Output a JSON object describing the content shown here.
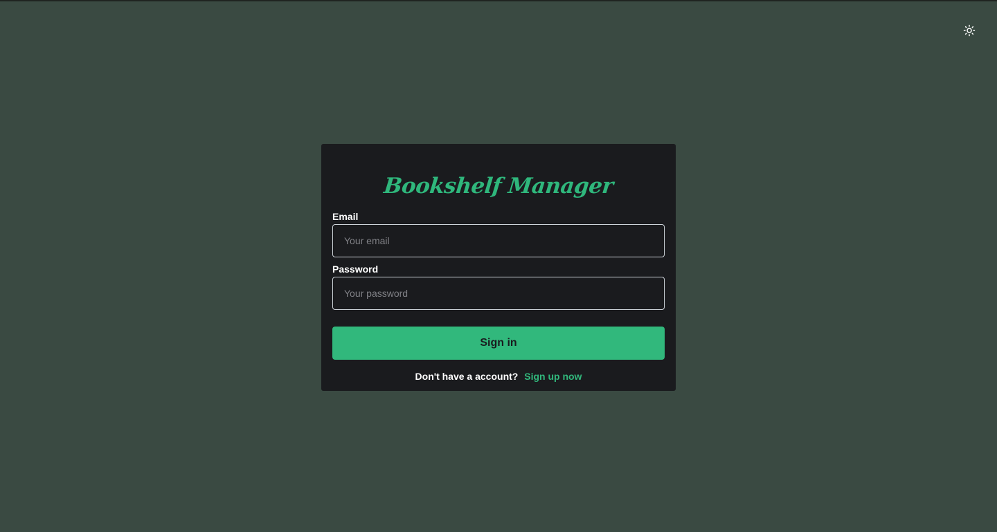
{
  "header": {
    "theme_toggle_icon": "sun-icon"
  },
  "login": {
    "brand_title": "Bookshelf Manager",
    "email_label": "Email",
    "email_placeholder": "Your email",
    "email_value": "",
    "password_label": "Password",
    "password_placeholder": "Your password",
    "password_value": "",
    "submit_label": "Sign in",
    "signup_prompt": "Don't have a account?",
    "signup_link": "Sign up now"
  },
  "colors": {
    "background": "#3a4a42",
    "card": "#1a1b1e",
    "accent": "#31b87c",
    "input_border": "#ced4da",
    "text": "#ffffff",
    "placeholder": "#808186"
  }
}
